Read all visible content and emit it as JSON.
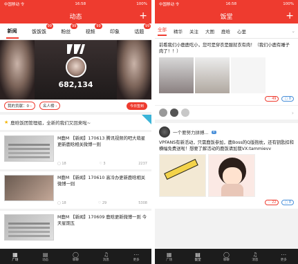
{
  "left": {
    "status": {
      "carrier": "中国移动 令",
      "time": "16:58",
      "battery": "100%"
    },
    "title": "动态",
    "tabs": [
      {
        "label": "新闻",
        "badge": ""
      },
      {
        "label": "饭饭饭",
        "badge": "99"
      },
      {
        "label": "粉丝",
        "badge": "99"
      },
      {
        "label": "视频",
        "badge": "99"
      },
      {
        "label": "印象",
        "badge": ""
      },
      {
        "label": "话题",
        "badge": "99"
      }
    ],
    "banner": {
      "count": "682,134"
    },
    "pills": {
      "contribution": "我的贡献：0",
      "rank": "名人榜"
    },
    "sign_button": "今日签到",
    "notice": "鹿晗饭团管理组，全新的我们又回来啦~",
    "posts": [
      {
        "text": "M鹿M 【新闻】170613 腾讯视频的吧大萌星更新鹿晗相关微博一则",
        "comments": "18",
        "likes": "3",
        "views": "2237"
      },
      {
        "text": "M鹿M 【新闻】170610 高冷办更新鹿晗相关微博一则",
        "comments": "18",
        "likes": "29",
        "views": "5308"
      },
      {
        "text": "M鹿M 【新闻】170609 鹿晗更新微博一则 今天星期五",
        "comments": "",
        "likes": "",
        "views": ""
      }
    ],
    "bottom_nav": [
      "广场",
      "动态",
      "聊聊",
      "消息",
      "更多"
    ]
  },
  "right": {
    "status": {
      "carrier": "中国移动 令",
      "time": "16:58",
      "battery": "100%"
    },
    "title": "饭堂",
    "tabs": [
      "全部",
      "精华",
      "关注",
      "大图",
      "鹿晗",
      "心里"
    ],
    "card1": {
      "text": "前看我们小鹿鹿吃小，您可是穿衣是服就衣有肉！（我们小鹿有睡子肉了！！）",
      "likes": "49",
      "comments": "8"
    },
    "card2": {
      "user": "一个要努力拼搏...",
      "text": "VPFANS有新活动，只需鹿饭参加，鹿Boss的Q版抱枕，还有钥匙扣和横幅免费送啦！想要了解活动的鹿饭请加我VX:tammievv",
      "likes": "22",
      "comments": "8"
    },
    "bottom_nav": [
      "广场",
      "饭堂",
      "聊聊",
      "消息",
      "更多"
    ]
  }
}
